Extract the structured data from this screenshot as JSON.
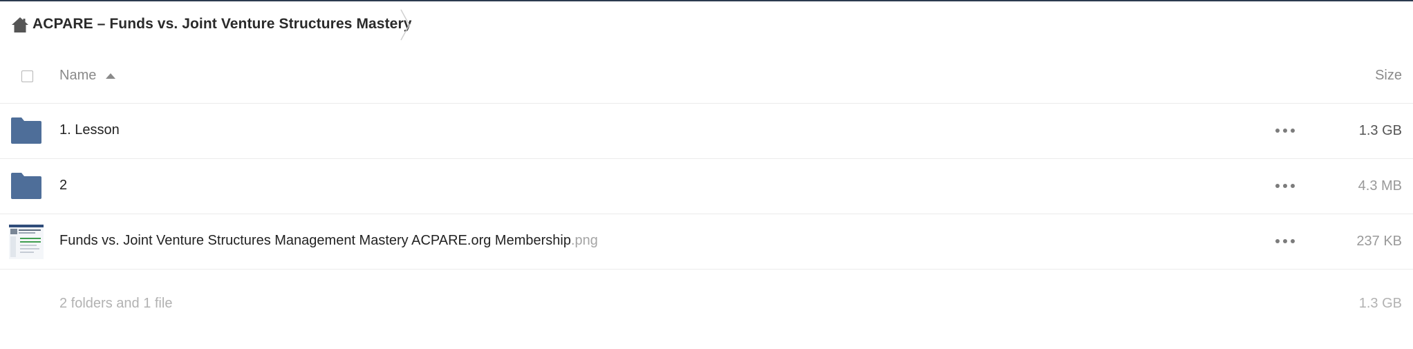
{
  "breadcrumb": {
    "home_icon": "home-icon",
    "current": "ACPARE – Funds vs. Joint Venture Structures Mastery"
  },
  "table": {
    "columns": {
      "name": "Name",
      "size": "Size"
    },
    "sort": "name-ascending",
    "rows": [
      {
        "icon": "folder-icon",
        "name": "1. Lesson",
        "extension": "",
        "size": "1.3 GB"
      },
      {
        "icon": "folder-icon",
        "name": "2",
        "extension": "",
        "size": "4.3 MB"
      },
      {
        "icon": "image-thumbnail-icon",
        "name": "Funds vs. Joint Venture Structures Management Mastery ACPARE.org Membership",
        "extension": ".png",
        "size": "237 KB"
      }
    ],
    "summary": {
      "text": "2 folders and 1 file",
      "size": "1.3 GB"
    }
  },
  "colors": {
    "folder": "#4e6e99",
    "header_line": "#2b3a4f",
    "muted_text": "#8a8a8a"
  }
}
